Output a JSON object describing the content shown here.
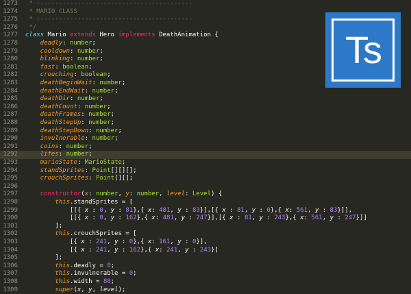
{
  "editor": {
    "highlight_line": "1292",
    "lines": [
      {
        "n": "1273",
        "tokens": [
          {
            "c": "comment",
            "t": " * ------------------------------------------"
          }
        ]
      },
      {
        "n": "1274",
        "tokens": [
          {
            "c": "comment",
            "t": " * MARIO CLASS"
          }
        ]
      },
      {
        "n": "1275",
        "tokens": [
          {
            "c": "comment",
            "t": " * ------------------------------------------"
          }
        ]
      },
      {
        "n": "1276",
        "tokens": [
          {
            "c": "comment",
            "t": " */"
          }
        ]
      },
      {
        "n": "1277",
        "tokens": [
          {
            "c": "keyword",
            "t": "class "
          },
          {
            "c": "plain",
            "t": "Mario "
          },
          {
            "c": "kw-red",
            "t": "extends "
          },
          {
            "c": "plain",
            "t": "Hero "
          },
          {
            "c": "kw-red",
            "t": "implements "
          },
          {
            "c": "plain",
            "t": "DeathAnimation {"
          }
        ]
      },
      {
        "n": "1278",
        "tokens": [
          {
            "c": "prop",
            "t": "    deadly"
          },
          {
            "c": "plain",
            "t": ": "
          },
          {
            "c": "type",
            "t": "number"
          },
          {
            "c": "plain",
            "t": ";"
          }
        ]
      },
      {
        "n": "1279",
        "tokens": [
          {
            "c": "prop",
            "t": "    cooldown"
          },
          {
            "c": "plain",
            "t": ": "
          },
          {
            "c": "type",
            "t": "number"
          },
          {
            "c": "plain",
            "t": ";"
          }
        ]
      },
      {
        "n": "1280",
        "tokens": [
          {
            "c": "prop",
            "t": "    blinking"
          },
          {
            "c": "plain",
            "t": ": "
          },
          {
            "c": "type",
            "t": "number"
          },
          {
            "c": "plain",
            "t": ";"
          }
        ]
      },
      {
        "n": "1281",
        "tokens": [
          {
            "c": "prop",
            "t": "    fast"
          },
          {
            "c": "plain",
            "t": ": "
          },
          {
            "c": "type",
            "t": "boolean"
          },
          {
            "c": "plain",
            "t": ";"
          }
        ]
      },
      {
        "n": "1282",
        "tokens": [
          {
            "c": "prop",
            "t": "    crouching"
          },
          {
            "c": "plain",
            "t": ": "
          },
          {
            "c": "type",
            "t": "boolean"
          },
          {
            "c": "plain",
            "t": ";"
          }
        ]
      },
      {
        "n": "1283",
        "tokens": [
          {
            "c": "prop",
            "t": "    deathBeginWait"
          },
          {
            "c": "plain",
            "t": ": "
          },
          {
            "c": "type",
            "t": "number"
          },
          {
            "c": "plain",
            "t": ";"
          }
        ]
      },
      {
        "n": "1284",
        "tokens": [
          {
            "c": "prop",
            "t": "    deathEndWait"
          },
          {
            "c": "plain",
            "t": ": "
          },
          {
            "c": "type",
            "t": "number"
          },
          {
            "c": "plain",
            "t": ";"
          }
        ]
      },
      {
        "n": "1285",
        "tokens": [
          {
            "c": "prop",
            "t": "    deathDir"
          },
          {
            "c": "plain",
            "t": ": "
          },
          {
            "c": "type",
            "t": "number"
          },
          {
            "c": "plain",
            "t": ";"
          }
        ]
      },
      {
        "n": "1286",
        "tokens": [
          {
            "c": "prop",
            "t": "    deathCount"
          },
          {
            "c": "plain",
            "t": ": "
          },
          {
            "c": "type",
            "t": "number"
          },
          {
            "c": "plain",
            "t": ";"
          }
        ]
      },
      {
        "n": "1287",
        "tokens": [
          {
            "c": "prop",
            "t": "    deathFrames"
          },
          {
            "c": "plain",
            "t": ": "
          },
          {
            "c": "type",
            "t": "number"
          },
          {
            "c": "plain",
            "t": ";"
          }
        ]
      },
      {
        "n": "1288",
        "tokens": [
          {
            "c": "prop",
            "t": "    deathStepUp"
          },
          {
            "c": "plain",
            "t": ": "
          },
          {
            "c": "type",
            "t": "number"
          },
          {
            "c": "plain",
            "t": ";"
          }
        ]
      },
      {
        "n": "1289",
        "tokens": [
          {
            "c": "prop",
            "t": "    deathStepDown"
          },
          {
            "c": "plain",
            "t": ": "
          },
          {
            "c": "type",
            "t": "number"
          },
          {
            "c": "plain",
            "t": ";"
          }
        ]
      },
      {
        "n": "1290",
        "tokens": [
          {
            "c": "prop",
            "t": "    invulnerable"
          },
          {
            "c": "plain",
            "t": ": "
          },
          {
            "c": "type",
            "t": "number"
          },
          {
            "c": "plain",
            "t": ";"
          }
        ]
      },
      {
        "n": "1291",
        "tokens": [
          {
            "c": "prop",
            "t": "    coins"
          },
          {
            "c": "plain",
            "t": ": "
          },
          {
            "c": "type",
            "t": "number"
          },
          {
            "c": "plain",
            "t": ";"
          }
        ]
      },
      {
        "n": "1292",
        "tokens": [
          {
            "c": "prop",
            "t": "    lifes"
          },
          {
            "c": "plain",
            "t": ": "
          },
          {
            "c": "type",
            "t": "number"
          },
          {
            "c": "plain",
            "t": ";"
          }
        ]
      },
      {
        "n": "1293",
        "tokens": [
          {
            "c": "prop",
            "t": "    marioState"
          },
          {
            "c": "plain",
            "t": ": "
          },
          {
            "c": "type",
            "t": "MarioState"
          },
          {
            "c": "plain",
            "t": ";"
          }
        ]
      },
      {
        "n": "1294",
        "tokens": [
          {
            "c": "prop",
            "t": "    standSprites"
          },
          {
            "c": "plain",
            "t": ": "
          },
          {
            "c": "type",
            "t": "Point"
          },
          {
            "c": "plain",
            "t": "[][][];"
          }
        ]
      },
      {
        "n": "1295",
        "tokens": [
          {
            "c": "prop",
            "t": "    crouchSprites"
          },
          {
            "c": "plain",
            "t": ": "
          },
          {
            "c": "type",
            "t": "Point"
          },
          {
            "c": "plain",
            "t": "[][];"
          }
        ]
      },
      {
        "n": "1296",
        "tokens": [
          {
            "c": "plain",
            "t": ""
          }
        ]
      },
      {
        "n": "1297",
        "tokens": [
          {
            "c": "kw-red",
            "t": "    constructor"
          },
          {
            "c": "plain",
            "t": "("
          },
          {
            "c": "prop",
            "t": "x"
          },
          {
            "c": "plain",
            "t": ": "
          },
          {
            "c": "type",
            "t": "number"
          },
          {
            "c": "plain",
            "t": ", "
          },
          {
            "c": "prop",
            "t": "y"
          },
          {
            "c": "plain",
            "t": ": "
          },
          {
            "c": "type",
            "t": "number"
          },
          {
            "c": "plain",
            "t": ", "
          },
          {
            "c": "prop",
            "t": "level"
          },
          {
            "c": "plain",
            "t": ": "
          },
          {
            "c": "type",
            "t": "Level"
          },
          {
            "c": "plain",
            "t": ") {"
          }
        ]
      },
      {
        "n": "1298",
        "tokens": [
          {
            "c": "this",
            "t": "        this"
          },
          {
            "c": "plain",
            "t": ".standSprites = ["
          }
        ]
      },
      {
        "n": "1299",
        "tokens": [
          {
            "c": "plain",
            "t": "            [[{ "
          },
          {
            "c": "italic",
            "t": "x "
          },
          {
            "c": "plain",
            "t": ": "
          },
          {
            "c": "num",
            "t": "0"
          },
          {
            "c": "plain",
            "t": ", "
          },
          {
            "c": "italic",
            "t": "y "
          },
          {
            "c": "plain",
            "t": ": "
          },
          {
            "c": "num",
            "t": "81"
          },
          {
            "c": "plain",
            "t": "},{ "
          },
          {
            "c": "italic",
            "t": "x"
          },
          {
            "c": "plain",
            "t": ": "
          },
          {
            "c": "num",
            "t": "481"
          },
          {
            "c": "plain",
            "t": ", "
          },
          {
            "c": "italic",
            "t": "y "
          },
          {
            "c": "plain",
            "t": ": "
          },
          {
            "c": "num",
            "t": "83"
          },
          {
            "c": "plain",
            "t": "}],[{ "
          },
          {
            "c": "italic",
            "t": "x "
          },
          {
            "c": "plain",
            "t": ": "
          },
          {
            "c": "num",
            "t": "81"
          },
          {
            "c": "plain",
            "t": ", "
          },
          {
            "c": "italic",
            "t": "y "
          },
          {
            "c": "plain",
            "t": ": "
          },
          {
            "c": "num",
            "t": "0"
          },
          {
            "c": "plain",
            "t": "},{ "
          },
          {
            "c": "italic",
            "t": "x"
          },
          {
            "c": "plain",
            "t": ": "
          },
          {
            "c": "num",
            "t": "561"
          },
          {
            "c": "plain",
            "t": ", "
          },
          {
            "c": "italic",
            "t": "y "
          },
          {
            "c": "plain",
            "t": ": "
          },
          {
            "c": "num",
            "t": "83"
          },
          {
            "c": "plain",
            "t": "}]],"
          }
        ]
      },
      {
        "n": "1300",
        "tokens": [
          {
            "c": "plain",
            "t": "            [[{ "
          },
          {
            "c": "italic",
            "t": "x "
          },
          {
            "c": "plain",
            "t": ": "
          },
          {
            "c": "num",
            "t": "0"
          },
          {
            "c": "plain",
            "t": ", "
          },
          {
            "c": "italic",
            "t": "y "
          },
          {
            "c": "plain",
            "t": ": "
          },
          {
            "c": "num",
            "t": "162"
          },
          {
            "c": "plain",
            "t": "},{ "
          },
          {
            "c": "italic",
            "t": "x"
          },
          {
            "c": "plain",
            "t": ": "
          },
          {
            "c": "num",
            "t": "481"
          },
          {
            "c": "plain",
            "t": ", "
          },
          {
            "c": "italic",
            "t": "y "
          },
          {
            "c": "plain",
            "t": ": "
          },
          {
            "c": "num",
            "t": "247"
          },
          {
            "c": "plain",
            "t": "}],[{ "
          },
          {
            "c": "italic",
            "t": "x "
          },
          {
            "c": "plain",
            "t": ": "
          },
          {
            "c": "num",
            "t": "81"
          },
          {
            "c": "plain",
            "t": ", "
          },
          {
            "c": "italic",
            "t": "y "
          },
          {
            "c": "plain",
            "t": ": "
          },
          {
            "c": "num",
            "t": "243"
          },
          {
            "c": "plain",
            "t": "},{ "
          },
          {
            "c": "italic",
            "t": "x"
          },
          {
            "c": "plain",
            "t": ": "
          },
          {
            "c": "num",
            "t": "561"
          },
          {
            "c": "plain",
            "t": ", "
          },
          {
            "c": "italic",
            "t": "y "
          },
          {
            "c": "plain",
            "t": ": "
          },
          {
            "c": "num",
            "t": "247"
          },
          {
            "c": "plain",
            "t": "}]]"
          }
        ]
      },
      {
        "n": "1301",
        "tokens": [
          {
            "c": "plain",
            "t": "        ];"
          }
        ]
      },
      {
        "n": "1302",
        "tokens": [
          {
            "c": "this",
            "t": "        this"
          },
          {
            "c": "plain",
            "t": ".crouchSprites = ["
          }
        ]
      },
      {
        "n": "1303",
        "tokens": [
          {
            "c": "plain",
            "t": "            [{ "
          },
          {
            "c": "italic",
            "t": "x "
          },
          {
            "c": "plain",
            "t": ": "
          },
          {
            "c": "num",
            "t": "241"
          },
          {
            "c": "plain",
            "t": ", "
          },
          {
            "c": "italic",
            "t": "y "
          },
          {
            "c": "plain",
            "t": ": "
          },
          {
            "c": "num",
            "t": "0"
          },
          {
            "c": "plain",
            "t": "},{ "
          },
          {
            "c": "italic",
            "t": "x"
          },
          {
            "c": "plain",
            "t": ": "
          },
          {
            "c": "num",
            "t": "161"
          },
          {
            "c": "plain",
            "t": ", "
          },
          {
            "c": "italic",
            "t": "y "
          },
          {
            "c": "plain",
            "t": ": "
          },
          {
            "c": "num",
            "t": "0"
          },
          {
            "c": "plain",
            "t": "}],"
          }
        ]
      },
      {
        "n": "1304",
        "tokens": [
          {
            "c": "plain",
            "t": "            [{ "
          },
          {
            "c": "italic",
            "t": "x "
          },
          {
            "c": "plain",
            "t": ": "
          },
          {
            "c": "num",
            "t": "241"
          },
          {
            "c": "plain",
            "t": ", "
          },
          {
            "c": "italic",
            "t": "y "
          },
          {
            "c": "plain",
            "t": ": "
          },
          {
            "c": "num",
            "t": "162"
          },
          {
            "c": "plain",
            "t": "},{ "
          },
          {
            "c": "italic",
            "t": "x"
          },
          {
            "c": "plain",
            "t": ": "
          },
          {
            "c": "num",
            "t": "241"
          },
          {
            "c": "plain",
            "t": ", "
          },
          {
            "c": "italic",
            "t": "y "
          },
          {
            "c": "plain",
            "t": ": "
          },
          {
            "c": "num",
            "t": "243"
          },
          {
            "c": "plain",
            "t": "}]"
          }
        ]
      },
      {
        "n": "1305",
        "tokens": [
          {
            "c": "plain",
            "t": "        ];"
          }
        ]
      },
      {
        "n": "1306",
        "tokens": [
          {
            "c": "this",
            "t": "        this"
          },
          {
            "c": "plain",
            "t": ".deadly = "
          },
          {
            "c": "num",
            "t": "0"
          },
          {
            "c": "plain",
            "t": ";"
          }
        ]
      },
      {
        "n": "1307",
        "tokens": [
          {
            "c": "this",
            "t": "        this"
          },
          {
            "c": "plain",
            "t": ".invulnerable = "
          },
          {
            "c": "num",
            "t": "0"
          },
          {
            "c": "plain",
            "t": ";"
          }
        ]
      },
      {
        "n": "1308",
        "tokens": [
          {
            "c": "this",
            "t": "        this"
          },
          {
            "c": "plain",
            "t": ".width = "
          },
          {
            "c": "num",
            "t": "80"
          },
          {
            "c": "plain",
            "t": ";"
          }
        ]
      },
      {
        "n": "1309",
        "tokens": [
          {
            "c": "this",
            "t": "        super"
          },
          {
            "c": "plain",
            "t": "("
          },
          {
            "c": "italic",
            "t": "x"
          },
          {
            "c": "plain",
            "t": ", "
          },
          {
            "c": "italic",
            "t": "y"
          },
          {
            "c": "plain",
            "t": ", "
          },
          {
            "c": "italic",
            "t": "level"
          },
          {
            "c": "plain",
            "t": ");"
          }
        ]
      }
    ]
  },
  "logo": {
    "text": "Ts",
    "icon": "typescript-logo-icon",
    "color": "#2d79c7"
  }
}
